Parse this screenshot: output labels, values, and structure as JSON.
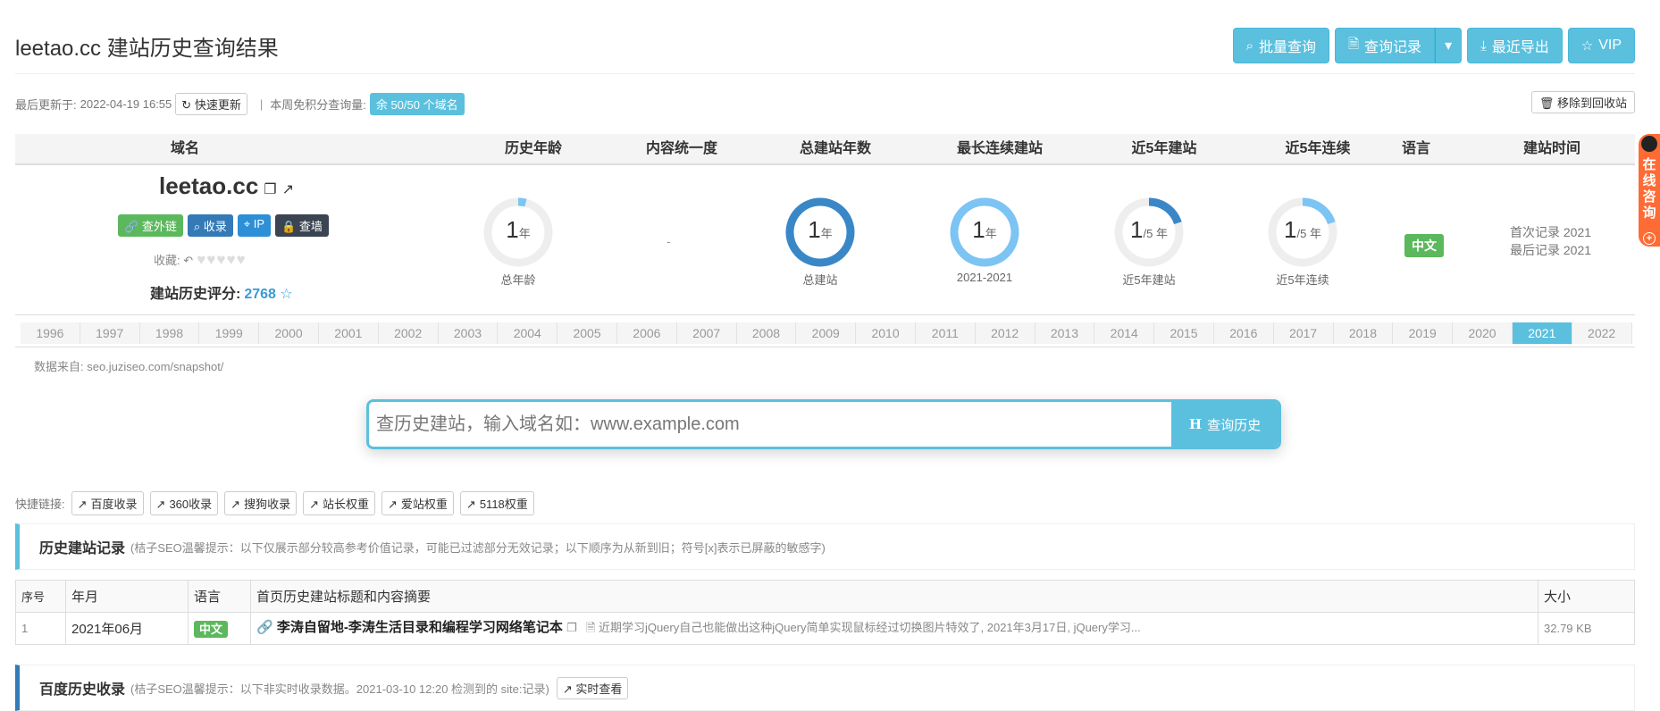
{
  "page_title": "leetao.cc 建站历史查询结果",
  "toolbar": {
    "batch_query": "批量查询",
    "query_records": "查询记录",
    "recent_export": "最近导出",
    "vip": "VIP"
  },
  "meta": {
    "updated_label": "最后更新于:",
    "updated_time": "2022-04-19 16:55",
    "quick_update": "快速更新",
    "weekly_label": "本周免积分查询量:",
    "weekly_quota": "余 50/50 个域名",
    "recycle": "移除到回收站"
  },
  "table_headers": [
    "域名",
    "历史年龄",
    "内容统一度",
    "总建站年数",
    "最长连续建站",
    "近5年建站",
    "近5年连续",
    "语言",
    "建站时间"
  ],
  "domain": {
    "name": "leetao.cc",
    "tags": [
      "查外链",
      "收录",
      "IP",
      "查墙"
    ],
    "fav_label": "收藏:",
    "score_label": "建站历史评分:",
    "score": "2768"
  },
  "stats": {
    "history_age": {
      "value": "1",
      "unit": "年",
      "caption": "总年龄",
      "fraction": 0.04
    },
    "content_unity": "-",
    "total_years": {
      "value": "1",
      "unit": "年",
      "caption": "总建站",
      "fraction": 1.0
    },
    "longest": {
      "value": "1",
      "unit": "年",
      "caption": "2021-2021",
      "fraction": 1.0
    },
    "recent5": {
      "value": "1",
      "unit": "/5 年",
      "caption": "近5年建站",
      "fraction": 0.2
    },
    "recent5_cont": {
      "value": "1",
      "unit": "/5 年",
      "caption": "近5年连续",
      "fraction": 0.2
    },
    "language": "中文",
    "first_record": "首次记录 2021",
    "last_record": "最后记录 2021"
  },
  "years": [
    "1996",
    "1997",
    "1998",
    "1999",
    "2000",
    "2001",
    "2002",
    "2003",
    "2004",
    "2005",
    "2006",
    "2007",
    "2008",
    "2009",
    "2010",
    "2011",
    "2012",
    "2013",
    "2014",
    "2015",
    "2016",
    "2017",
    "2018",
    "2019",
    "2020",
    "2021",
    "2022"
  ],
  "active_year": "2021",
  "source": "数据来自: seo.juziseo.com/snapshot/",
  "search": {
    "placeholder": "查历史建站，输入域名如：www.example.com",
    "button": "查询历史"
  },
  "quick_links": {
    "label": "快捷链接:",
    "items": [
      "百度收录",
      "360收录",
      "搜狗收录",
      "站长权重",
      "爱站权重",
      "5118权重"
    ]
  },
  "history_panel": {
    "title": "历史建站记录",
    "tip": "(桔子SEO温馨提示：以下仅展示部分较高参考价值记录，可能已过滤部分无效记录；以下顺序为从新到旧；符号[x]表示已屏蔽的敏感字)"
  },
  "history_table": {
    "headers": [
      "序号",
      "年月",
      "语言",
      "首页历史建站标题和内容摘要",
      "大小"
    ],
    "rows": [
      {
        "index": "1",
        "month": "2021年06月",
        "lang": "中文",
        "title": "李涛自留地-李涛生活目录和编程学习网络笔记本",
        "summary": "近期学习jQuery自己也能做出这种jQuery简单实现鼠标经过切换图片特效了, 2021年3月17日, jQuery学习...",
        "size": "32.79 KB"
      }
    ]
  },
  "baidu_panel": {
    "title": "百度历史收录",
    "tip": "(桔子SEO温馨提示：以下非实时收录数据。2021-03-10 12:20 检测到的 site:记录)",
    "button": "实时查看"
  },
  "consult": "在线咨询",
  "colors": {
    "accent": "#5bc0de",
    "donut_dark": "#3a87c8",
    "donut_light": "#7cc4f3",
    "track": "#eeeeee",
    "green": "#5cb85c"
  }
}
